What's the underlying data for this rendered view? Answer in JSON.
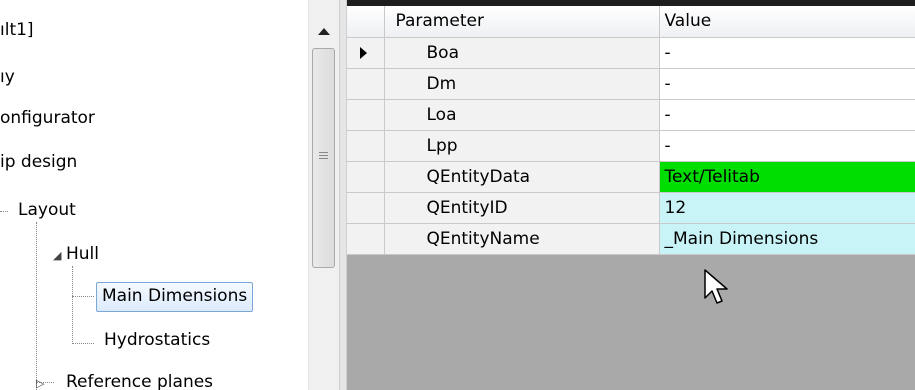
{
  "tree": {
    "nodes": [
      {
        "label": "ılt1]",
        "selected": false
      },
      {
        "label": "ıy",
        "selected": false
      },
      {
        "label": "onfigurator",
        "selected": false
      },
      {
        "label": "ip design",
        "selected": false
      },
      {
        "label": "Layout",
        "selected": false
      },
      {
        "label": "Hull",
        "selected": false
      },
      {
        "label": "Main Dimensions",
        "selected": true
      },
      {
        "label": "Hydrostatics",
        "selected": false
      },
      {
        "label": "Reference planes",
        "selected": false
      }
    ]
  },
  "grid": {
    "columns": {
      "parameter": "Parameter",
      "value": "Value"
    },
    "rows": [
      {
        "parameter": "Boa",
        "value": "-",
        "value_bg": "#ffffff",
        "current": true
      },
      {
        "parameter": "Dm",
        "value": "-",
        "value_bg": "#ffffff"
      },
      {
        "parameter": "Loa",
        "value": "-",
        "value_bg": "#ffffff"
      },
      {
        "parameter": "Lpp",
        "value": "-",
        "value_bg": "#ffffff"
      },
      {
        "parameter": "QEntityData",
        "value": "Text/Telitab",
        "value_bg": "#00dd00"
      },
      {
        "parameter": "QEntityID",
        "value": "12",
        "value_bg": "#c8f4f8"
      },
      {
        "parameter": "QEntityName",
        "value": "_Main Dimensions",
        "value_bg": "#c8f4f8"
      }
    ]
  },
  "colors": {
    "grid_empty": "#a9a9a9",
    "selection_border": "#7aa7d6"
  },
  "icons": {
    "scroll_up": "triangle-up",
    "row_indicator": "triangle-right",
    "cursor": "arrow-pointer"
  }
}
